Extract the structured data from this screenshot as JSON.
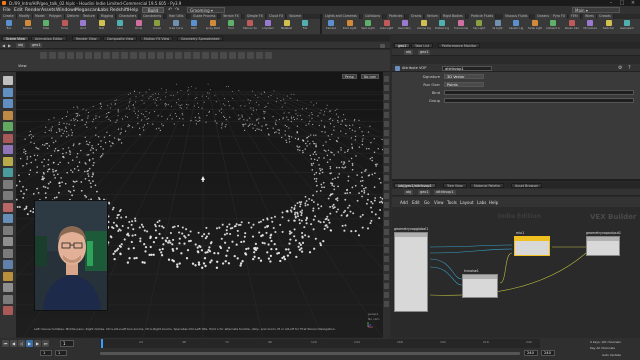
{
  "window": {
    "title": "D:/09_Intro/HIP/geo_talk_02.hiplc - Houdini Indie Limited-Commercial 19.5.605 - Py3.9",
    "buttons": [
      "minimize-icon",
      "maximize-icon",
      "close-icon"
    ]
  },
  "menubar": {
    "items": [
      "File",
      "Edit",
      "Render",
      "Assets",
      "Windows",
      "Megascans",
      "Labs",
      "Redshift",
      "Help"
    ],
    "build_label": "Build",
    "desktop_label": "Grooming",
    "main_label": "Main"
  },
  "shelf_left": {
    "tabs": [
      "Create",
      "Modify",
      "Model",
      "Polygon",
      "Deform",
      "Texture",
      "Rigging",
      "Characters",
      "Constraints",
      "Hair Utils",
      "Guide Process",
      "Terrain FX",
      "Simple FX",
      "Cloud FX",
      "Volume"
    ],
    "tools": [
      "Box",
      "Sphere",
      "Tube",
      "Torus",
      "Grid",
      "Null",
      "Line",
      "Circle",
      "Curve",
      "Draw Curve",
      "Path",
      "Spray Paint",
      "Font",
      "Platonic Solids",
      "L-System",
      "Metaball",
      "File"
    ]
  },
  "shelf_right": {
    "tabs": [
      "Lights and Cameras",
      "Collisions",
      "Particles",
      "Grains",
      "Vellum",
      "Rigid Bodies",
      "Particle Fluids",
      "Viscous Fluids",
      "Oceans",
      "Pyro FX",
      "FEM",
      "Wires",
      "Crowds",
      "Drive Simulation"
    ],
    "tools": [
      "Camera",
      "Point Light",
      "Spot Light",
      "Area Light",
      "Geometry Light",
      "Volume Light",
      "Distant Light",
      "Environment Light",
      "Sky Light",
      "GI Light",
      "Caustic Light",
      "Portal Light",
      "Ambient Light",
      "Stereo Camera",
      "VR Camera",
      "Switcher",
      "Gamepad Camera"
    ]
  },
  "left_panes": {
    "tabs": [
      "Scene View",
      "Animation Editor",
      "Render View",
      "Composite View",
      "Motion FX View",
      "Geometry Spreadsheet"
    ],
    "path": [
      "obj",
      "geo1"
    ],
    "viewport_header": "View",
    "persp_label": "Persp",
    "cam_label": "No cam",
    "status_line": "Left mouse tumbles. Middle pans. Right dollies. Ctrl+Alt+Left box-zooms. Ctrl+Right zooms. Spacebar-Ctrl-Left tilts. Hold L for alternate tumble, dolly, and zoom.    M or Alt+M for First Person Navigation.",
    "persp_footer": "persp1",
    "cam_footer": "No cam"
  },
  "right_top": {
    "tabs": [
      "geo1",
      "Take List",
      "Performance Monitor"
    ],
    "path": [
      "obj",
      "geo1"
    ],
    "node_type": "Attribute VOP",
    "node_name": "attribvop1",
    "parms": [
      {
        "label": "Signature",
        "value": "3D Vector"
      },
      {
        "label": "Run Over",
        "value": "Points"
      },
      {
        "label": "Bind",
        "value": ""
      },
      {
        "label": "Group",
        "value": ""
      }
    ]
  },
  "right_bottom": {
    "tabs": [
      "/obj/geo1/attribvop1",
      "Tree View",
      "Material Palette",
      "Asset Browser"
    ],
    "path": [
      "obj",
      "geo1",
      "attribvop1"
    ],
    "menu": [
      "Add",
      "Edit",
      "Go",
      "View",
      "Tools",
      "Layout",
      "Labs",
      "Help"
    ],
    "watermark_left": "Indie Edition",
    "watermark_right": "VEX Builder",
    "nodes": [
      {
        "name": "geometryvopglobal1",
        "id": "globals"
      },
      {
        "name": "mix1",
        "id": "mix"
      },
      {
        "name": "geometryvopoutput1",
        "id": "output"
      },
      {
        "name": "hvnoise1",
        "id": "noise"
      }
    ]
  },
  "timeline": {
    "frame": "1",
    "start": "1",
    "end": "240",
    "range_start": "1",
    "range_end": "240",
    "ticks": [
      "24",
      "48",
      "72",
      "96",
      "120",
      "144",
      "168",
      "192",
      "216",
      "240"
    ],
    "keys_label": "0 keys, 0/0 channels",
    "key_all_label": "Key All Channels",
    "auto_update": "Auto Update"
  },
  "colors": {
    "accent": "#f0a020",
    "shelf_bg": "#393939",
    "viewport_bg": "#161616",
    "point": "#eaeaea"
  }
}
